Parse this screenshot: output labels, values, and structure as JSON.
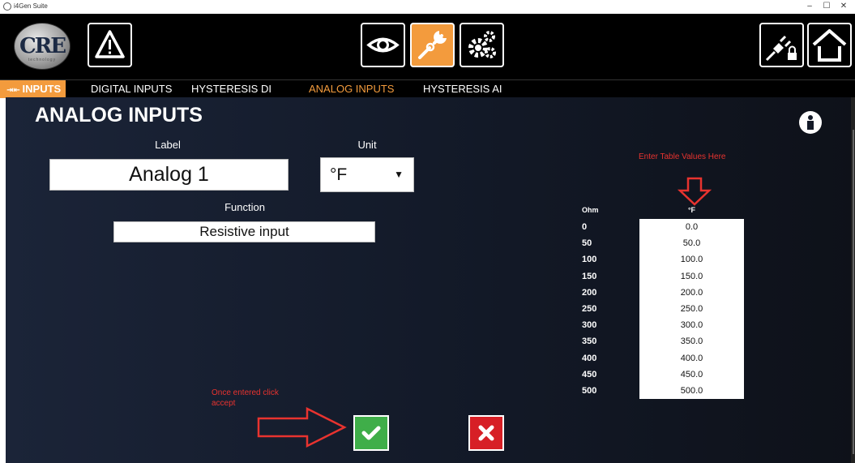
{
  "window": {
    "title": "i4Gen Suite",
    "controls": [
      "–",
      "☐",
      "✕"
    ]
  },
  "toolbar": {
    "logo_text": "CRE",
    "logo_sub": "technology",
    "buttons": [
      {
        "name": "alarm",
        "icon": "warning-icon",
        "active": false
      },
      {
        "name": "view",
        "icon": "eye-icon",
        "active": false
      },
      {
        "name": "configuration",
        "icon": "wrench-icon",
        "active": true
      },
      {
        "name": "settings",
        "icon": "gears-icon",
        "active": false
      },
      {
        "name": "connection",
        "icon": "plug-lock-icon",
        "active": false
      },
      {
        "name": "home",
        "icon": "home-icon",
        "active": false
      }
    ],
    "active_color": "#f39b3d"
  },
  "tabs": [
    {
      "label": "INPUTS",
      "icon": "arrows-icon"
    },
    {
      "label": "DIGITAL INPUTS"
    },
    {
      "label": "HYSTERESIS DI"
    },
    {
      "label": "ANALOG INPUTS",
      "current": true
    },
    {
      "label": "HYSTERESIS AI"
    }
  ],
  "page": {
    "title": "ANALOG INPUTS",
    "info_icon": "info-icon"
  },
  "form": {
    "label_heading": "Label",
    "label_value": "Analog 1",
    "unit_heading": "Unit",
    "unit_value": "°F",
    "function_heading": "Function",
    "function_value": "Resistive input"
  },
  "table": {
    "annotation": "Enter Table Values Here",
    "col_ohm": "Ohm",
    "col_unit": "°F",
    "rows": [
      {
        "ohm": "0",
        "value": "0.0"
      },
      {
        "ohm": "50",
        "value": "50.0"
      },
      {
        "ohm": "100",
        "value": "100.0"
      },
      {
        "ohm": "150",
        "value": "150.0"
      },
      {
        "ohm": "200",
        "value": "200.0"
      },
      {
        "ohm": "250",
        "value": "250.0"
      },
      {
        "ohm": "300",
        "value": "300.0"
      },
      {
        "ohm": "350",
        "value": "350.0"
      },
      {
        "ohm": "400",
        "value": "400.0"
      },
      {
        "ohm": "450",
        "value": "450.0"
      },
      {
        "ohm": "500",
        "value": "500.0"
      }
    ]
  },
  "actions": {
    "annotation_line1": "Once entered click",
    "annotation_line2": "accept",
    "accept_color": "#3fae49",
    "cancel_color": "#d71f26"
  }
}
